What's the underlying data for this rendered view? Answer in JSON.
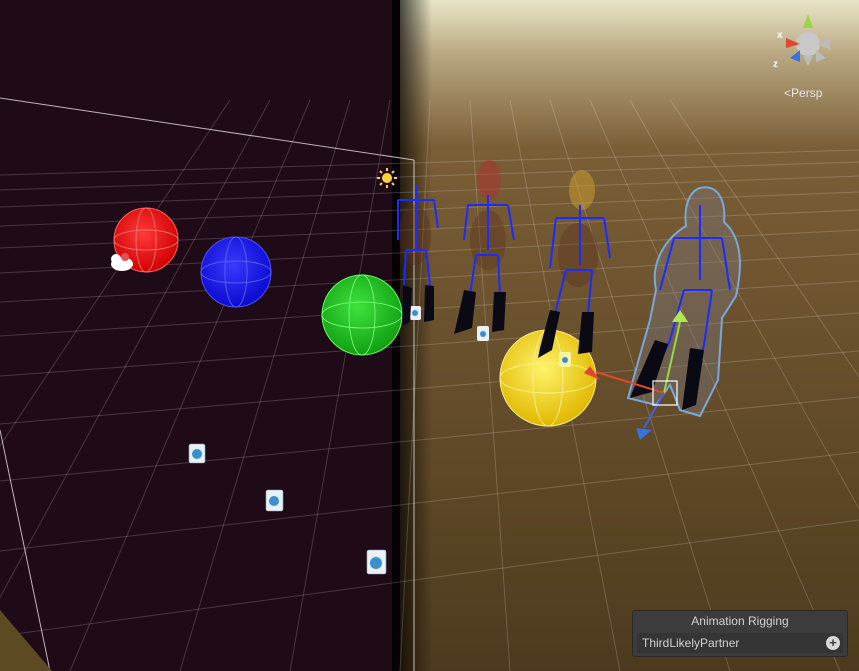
{
  "scene_view": {
    "projection_label": "Persp",
    "gizmo_axes": [
      "x",
      "z"
    ]
  },
  "overlay": {
    "title": "Animation Rigging",
    "item": "ThirdLikelyPartner",
    "add_icon": "plus-circle-icon"
  },
  "colors": {
    "left_background": "#1f0a18",
    "right_background": "#4a3820",
    "grid": "#ffffff",
    "bones": "#1a2cff",
    "sphere_red": "#ff0a0a",
    "sphere_blue": "#1414ff",
    "sphere_green": "#16c216",
    "sphere_yellow": "#f2d400"
  },
  "icons": [
    "light-sun-icon",
    "audio-source-icon",
    "scene-gizmo-icon",
    "camera-cloud-icon"
  ]
}
